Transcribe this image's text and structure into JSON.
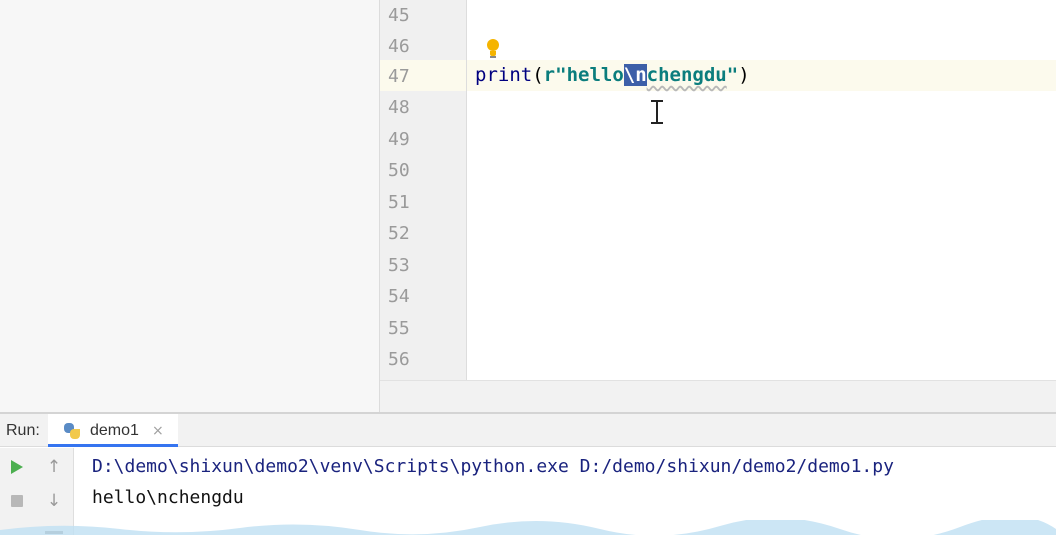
{
  "editor": {
    "line_numbers": [
      "45",
      "46",
      "47",
      "48",
      "49",
      "50",
      "51",
      "52",
      "53",
      "54",
      "55",
      "56"
    ],
    "current_line": "47",
    "code": {
      "function": "print",
      "open_paren": "(",
      "prefix": "r",
      "quote_open": "\"",
      "before_selection": "hello",
      "selection": "\\n",
      "after_selection": "chengdu",
      "quote_close": "\"",
      "close_paren": ")"
    },
    "intention_icon": "lightbulb-icon"
  },
  "run_panel": {
    "label": "Run:",
    "tab": {
      "label": "demo1",
      "icon": "python-icon",
      "close_glyph": "×"
    },
    "toolbar": {
      "rerun_icon": "play-icon",
      "stop_icon": "stop-icon",
      "up_glyph": "↑",
      "down_glyph": "↓",
      "wrap_icon": "soft-wrap-icon"
    },
    "console": {
      "command": "D:\\demo\\shixun\\demo2\\venv\\Scripts\\python.exe D:/demo/shixun/demo2/demo1.py",
      "output": "hello\\nchengdu"
    }
  },
  "colors": {
    "selection": "#3d5fa8",
    "string": "#0b7d7d",
    "function": "#000080",
    "current_line": "#fcfaed",
    "run_icon": "#4caf50",
    "tab_underline": "#3574f0"
  }
}
